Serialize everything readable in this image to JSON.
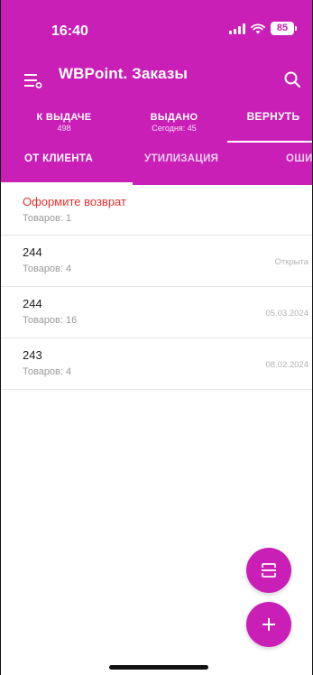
{
  "status_bar": {
    "time": "16:40",
    "battery": "85"
  },
  "app_bar": {
    "title": "WBPoint. Заказы"
  },
  "top_tabs": [
    {
      "label": "К ВЫДАЧЕ",
      "sub": "498"
    },
    {
      "label": "ВЫДАНО",
      "sub": "Сегодня: 45"
    },
    {
      "label": "ВЕРНУТЬ",
      "sub": ""
    }
  ],
  "sub_tabs": [
    {
      "label": "ОТ КЛИЕНТА"
    },
    {
      "label": "УТИЛИЗАЦИЯ"
    },
    {
      "label": "ОШИ"
    }
  ],
  "returns": [
    {
      "title": "Оформите возврат",
      "sub": "Товаров: 1",
      "right": ""
    },
    {
      "title": "244",
      "sub": "Товаров: 4",
      "right": "Открыта"
    },
    {
      "title": "244",
      "sub": "Товаров: 16",
      "right": "05.03.2024"
    },
    {
      "title": "243",
      "sub": "Товаров: 4",
      "right": "08.02.2024"
    }
  ],
  "icons": {
    "menu": "menu-icon",
    "search": "search-icon",
    "scan": "scan-icon",
    "add": "plus-icon"
  },
  "colors": {
    "brand": "#c91fb7",
    "alert": "#e2312c"
  }
}
